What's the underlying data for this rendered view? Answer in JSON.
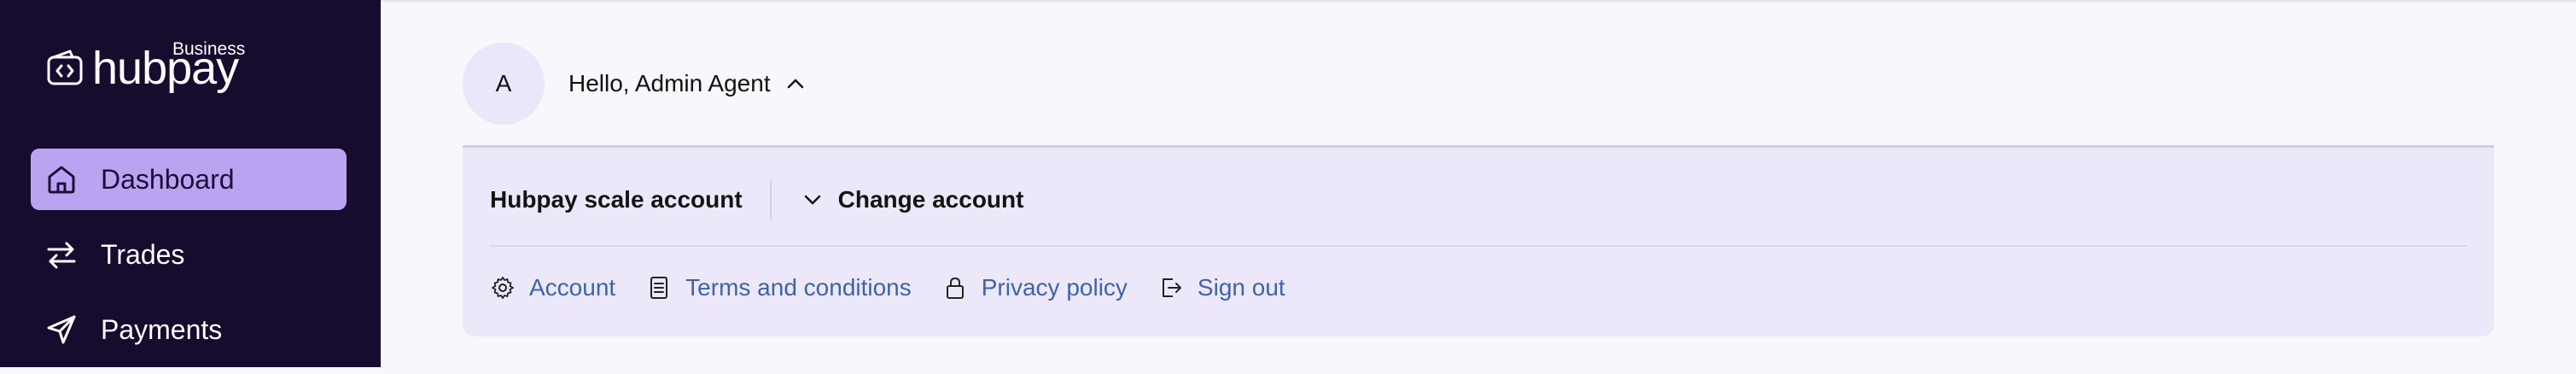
{
  "brand": {
    "name": "hubpay",
    "tier": "Business"
  },
  "sidebar": {
    "items": [
      {
        "label": "Dashboard",
        "icon": "home-icon",
        "active": true
      },
      {
        "label": "Trades",
        "icon": "arrows-swap-icon",
        "active": false
      },
      {
        "label": "Payments",
        "icon": "send-icon",
        "active": false
      }
    ]
  },
  "header": {
    "avatar_initial": "A",
    "greeting": "Hello, Admin Agent",
    "menu_icon": "chevron-up-icon"
  },
  "account_panel": {
    "account_name": "Hubpay scale account",
    "change_label": "Change account",
    "change_icon": "chevron-down-icon",
    "links": [
      {
        "label": "Account",
        "icon": "gear-icon"
      },
      {
        "label": "Terms and conditions",
        "icon": "document-icon"
      },
      {
        "label": "Privacy policy",
        "icon": "lock-icon"
      },
      {
        "label": "Sign out",
        "icon": "sign-out-icon"
      }
    ]
  },
  "colors": {
    "sidebar_bg": "#170b2e",
    "active_nav_bg": "#b9a4f1",
    "panel_bg": "#ece8fa",
    "link_color": "#3f63a8",
    "page_bg": "#f7f7fc"
  }
}
